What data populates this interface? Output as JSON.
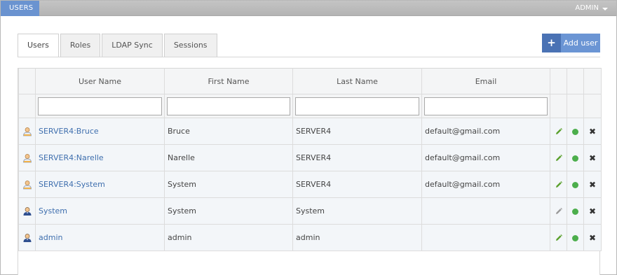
{
  "topbar": {
    "section_label": "USERS",
    "admin_label": "ADMIN"
  },
  "tabs": [
    {
      "label": "Users",
      "active": true
    },
    {
      "label": "Roles",
      "active": false
    },
    {
      "label": "LDAP Sync",
      "active": false
    },
    {
      "label": "Sessions",
      "active": false
    }
  ],
  "add_button": {
    "icon": "plus-icon",
    "label": "Add user"
  },
  "grid": {
    "columns": [
      "User Name",
      "First Name",
      "Last Name",
      "Email"
    ],
    "filters": [
      {
        "value": "",
        "placeholder": ""
      },
      {
        "value": "",
        "placeholder": ""
      },
      {
        "value": "",
        "placeholder": ""
      },
      {
        "value": "",
        "placeholder": ""
      }
    ],
    "rows": [
      {
        "type": "ldap",
        "user_name": "SERVER4:Bruce",
        "first_name": "Bruce",
        "last_name": "SERVER4",
        "email": "default@gmail.com",
        "editable": true,
        "active": true
      },
      {
        "type": "ldap",
        "user_name": "SERVER4:Narelle",
        "first_name": "Narelle",
        "last_name": "SERVER4",
        "email": "default@gmail.com",
        "editable": true,
        "active": true
      },
      {
        "type": "ldap",
        "user_name": "SERVER4:System",
        "first_name": "System",
        "last_name": "SERVER4",
        "email": "default@gmail.com",
        "editable": true,
        "active": true
      },
      {
        "type": "local",
        "user_name": "System",
        "first_name": "System",
        "last_name": "System",
        "email": "",
        "editable": false,
        "active": true
      },
      {
        "type": "local",
        "user_name": "admin",
        "first_name": "admin",
        "last_name": "admin",
        "email": "",
        "editable": true,
        "active": true
      }
    ]
  },
  "colors": {
    "accent": "#6a93d0",
    "accent_dark": "#4a72b4",
    "link": "#3f6fae",
    "active_dot": "#4cae4c",
    "edit_enabled": "#5aa02c",
    "edit_disabled": "#9a9a9a"
  }
}
